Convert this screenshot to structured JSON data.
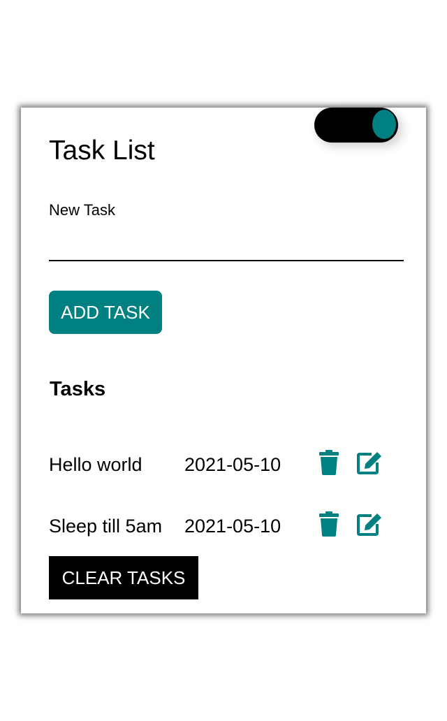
{
  "header": {
    "title": "Task List",
    "theme_toggle_icon": "toggle-switch"
  },
  "form": {
    "new_task_label": "New Task",
    "new_task_value": "",
    "add_button_label": "ADD TASK"
  },
  "tasks_section": {
    "heading": "Tasks",
    "items": [
      {
        "name": "Hello world",
        "date": "2021-05-10",
        "delete_icon": "trash-icon",
        "edit_icon": "edit-icon"
      },
      {
        "name": "Sleep till 5am",
        "date": "2021-05-10",
        "delete_icon": "trash-icon",
        "edit_icon": "edit-icon"
      }
    ],
    "clear_button_label": "CLEAR TASKS"
  },
  "colors": {
    "accent": "#008080",
    "text": "#000000",
    "clear_button_bg": "#000000"
  }
}
